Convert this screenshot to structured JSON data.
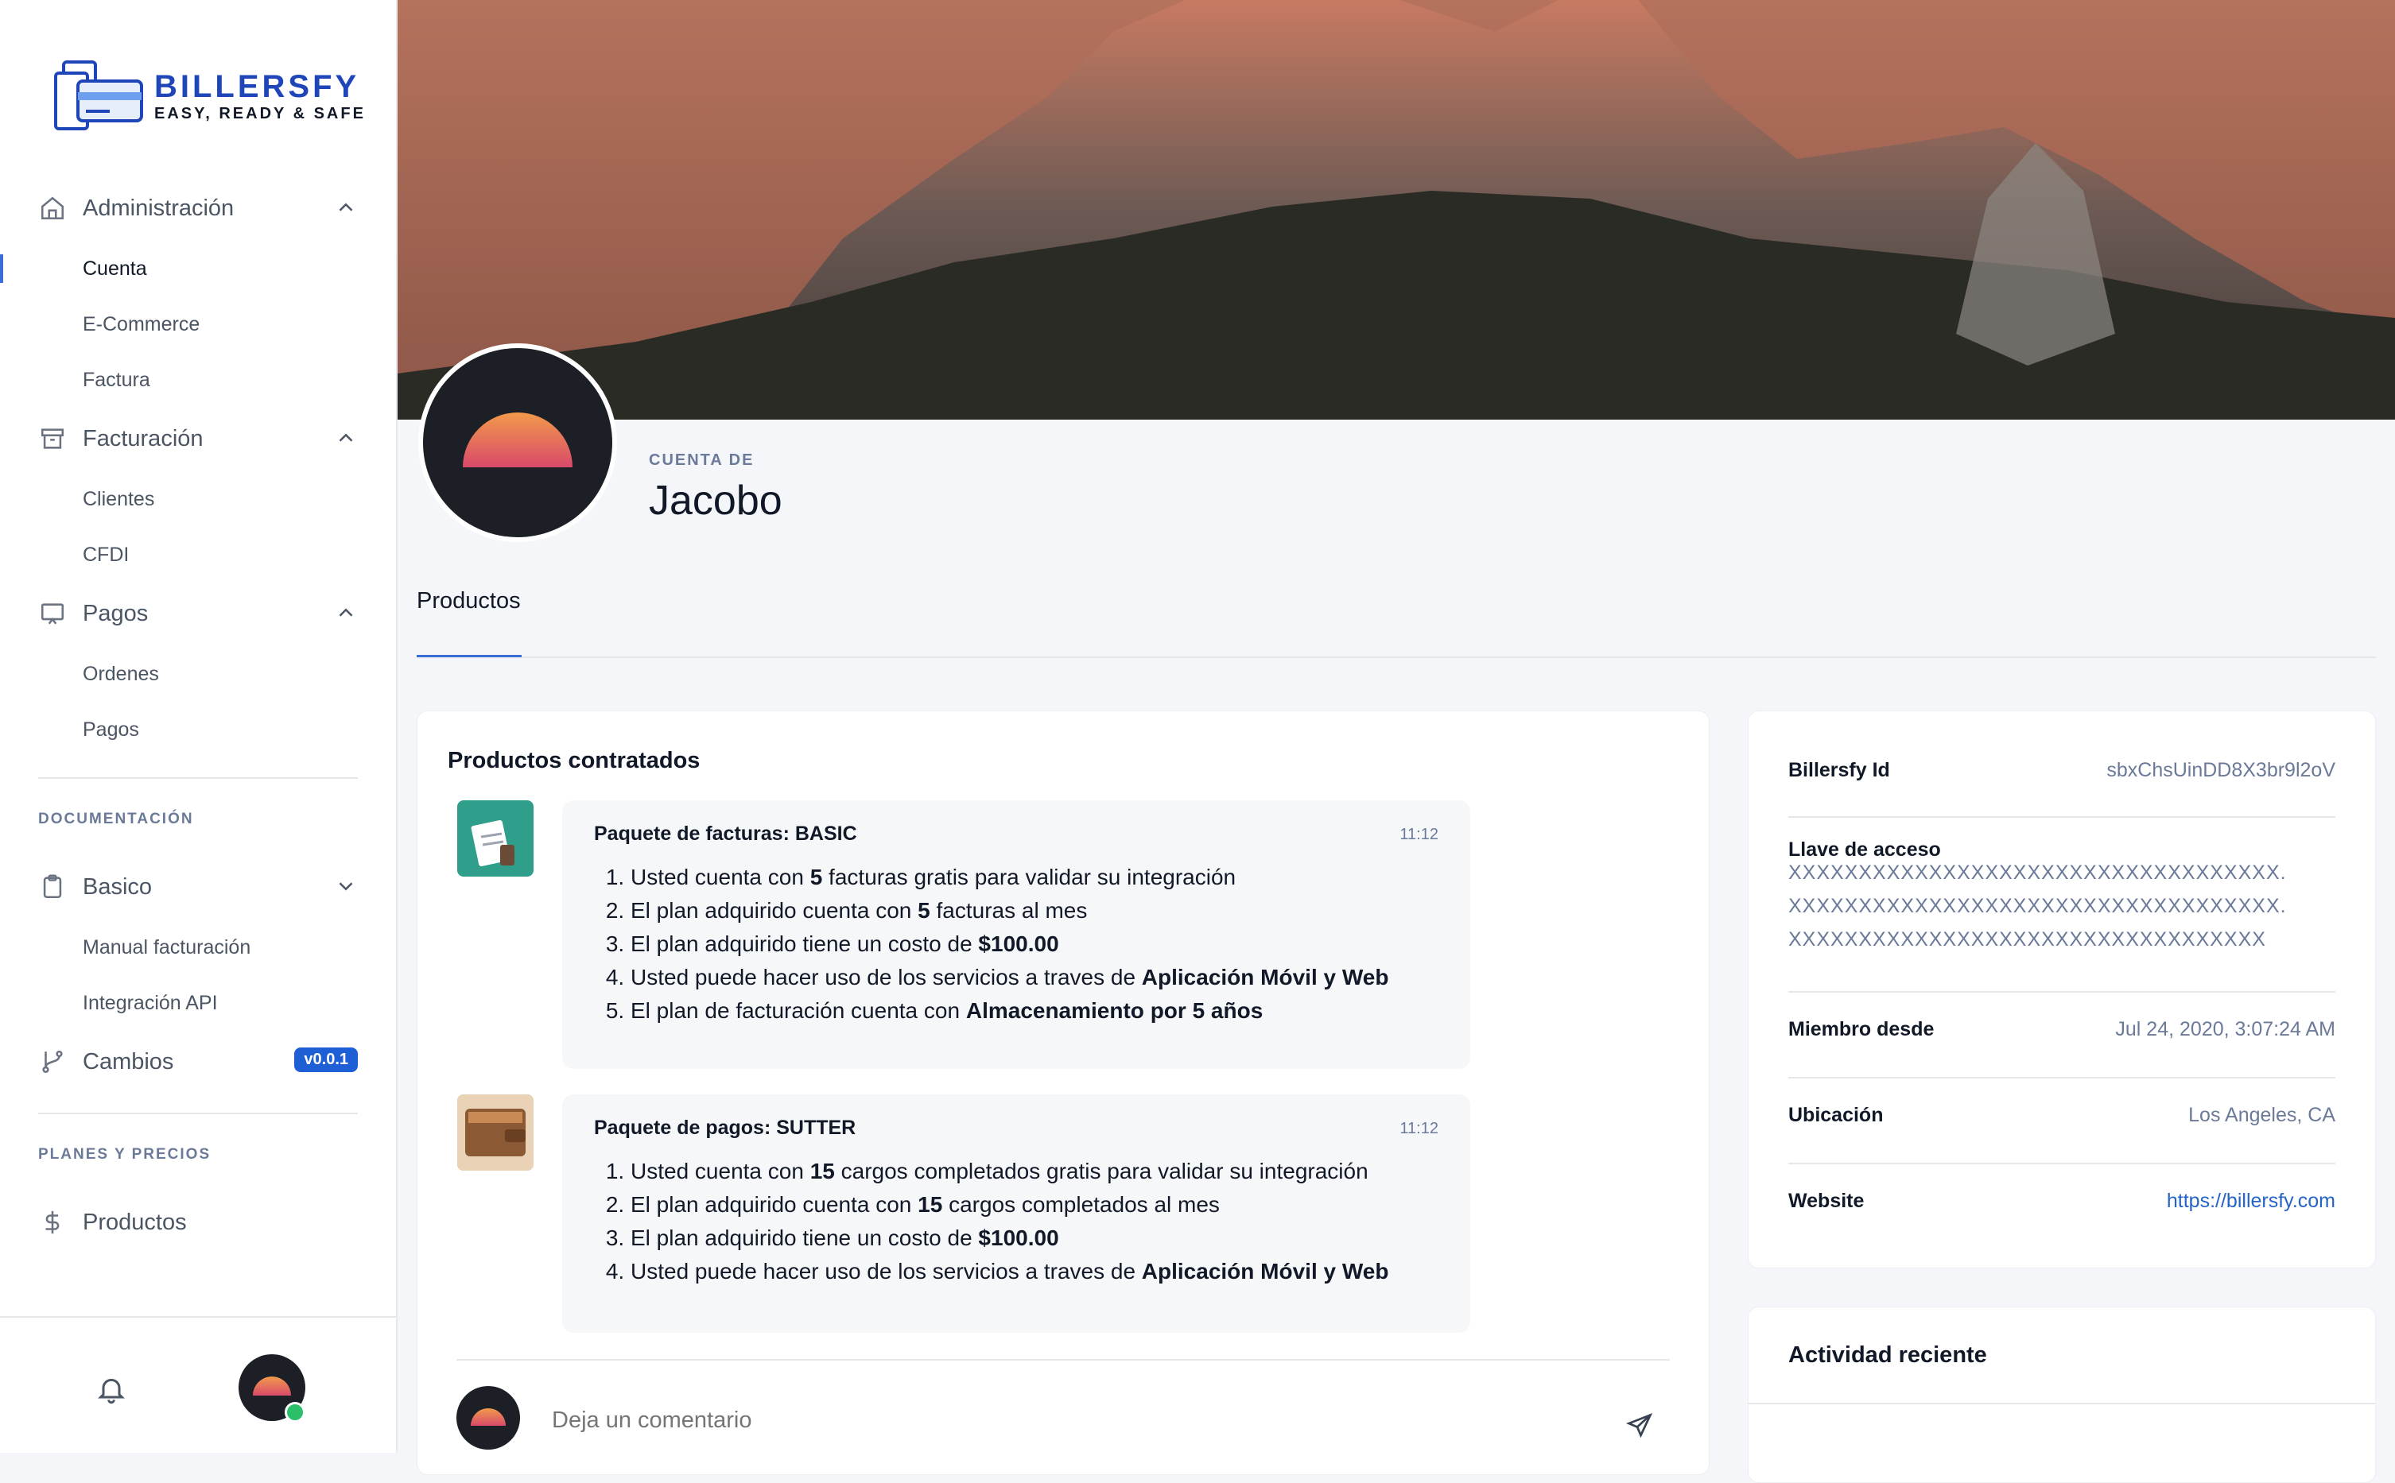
{
  "app": {
    "brand": "BILLERSFY",
    "tagline": "EASY, READY & SAFE"
  },
  "sidebar": {
    "groups": [
      {
        "label": "Administración",
        "icon": "home-icon",
        "expanded": true,
        "items": [
          "Cuenta",
          "E-Commerce",
          "Factura"
        ]
      },
      {
        "label": "Facturación",
        "icon": "archive-icon",
        "expanded": true,
        "items": [
          "Clientes",
          "CFDI"
        ]
      },
      {
        "label": "Pagos",
        "icon": "monitor-icon",
        "expanded": true,
        "items": [
          "Ordenes",
          "Pagos"
        ]
      }
    ],
    "active_item": "Cuenta",
    "doc_section": "DOCUMENTACIÓN",
    "doc_group": {
      "label": "Basico",
      "icon": "clipboard-icon",
      "expanded": false,
      "items": [
        "Manual facturación",
        "Integración API"
      ]
    },
    "changes": {
      "label": "Cambios",
      "badge": "v0.0.1"
    },
    "plans_section": "PLANES Y PRECIOS",
    "products": {
      "label": "Productos"
    }
  },
  "profile": {
    "account_label": "CUENTA DE",
    "name": "Jacobo",
    "tabs": [
      "Productos"
    ]
  },
  "products_card": {
    "title": "Productos contratados",
    "items": [
      {
        "title": "Paquete de facturas: BASIC",
        "time": "11:12",
        "lines": [
          {
            "pre": "Usted cuenta con ",
            "bold": "5",
            "post": " facturas gratis para validar su integración"
          },
          {
            "pre": "El plan adquirido cuenta con ",
            "bold": "5",
            "post": " facturas al mes"
          },
          {
            "pre": "El plan adquirido tiene un costo de ",
            "bold": "$100.00",
            "post": ""
          },
          {
            "pre": "Usted puede hacer uso de los servicios a traves de ",
            "bold": "Aplicación Móvil y Web",
            "post": ""
          },
          {
            "pre": "El plan de facturación cuenta con ",
            "bold": "Almacenamiento por 5 años",
            "post": ""
          }
        ]
      },
      {
        "title": "Paquete de pagos: SUTTER",
        "time": "11:12",
        "lines": [
          {
            "pre": "Usted cuenta con ",
            "bold": "15",
            "post": " cargos completados gratis para validar su integración"
          },
          {
            "pre": "El plan adquirido cuenta con ",
            "bold": "15",
            "post": " cargos completados al mes"
          },
          {
            "pre": "El plan adquirido tiene un costo de ",
            "bold": "$100.00",
            "post": ""
          },
          {
            "pre": "Usted puede hacer uso de los servicios a traves de ",
            "bold": "Aplicación Móvil y Web",
            "post": ""
          }
        ]
      }
    ],
    "comment_placeholder": "Deja un comentario"
  },
  "info_card": {
    "billersfy_id_label": "Billersfy Id",
    "billersfy_id": "sbxChsUinDD8X3br9l2oV",
    "access_key_label": "Llave de acceso",
    "access_key_lines": [
      "XXXXXXXXXXXXXXXXXXXXXXXXXXXXXXXXXXX.",
      "XXXXXXXXXXXXXXXXXXXXXXXXXXXXXXXXXXX.",
      "XXXXXXXXXXXXXXXXXXXXXXXXXXXXXXXXXX"
    ],
    "member_since_label": "Miembro desde",
    "member_since": "Jul 24, 2020, 3:07:24 AM",
    "location_label": "Ubicación",
    "location": "Los Angeles, CA",
    "website_label": "Website",
    "website": "https://billersfy.com"
  },
  "activity_card": {
    "title": "Actividad reciente"
  },
  "colors": {
    "accent": "#3b6fd8",
    "brand": "#1f46b8",
    "badge": "#1f5fd6",
    "online": "#2bbf6a"
  }
}
